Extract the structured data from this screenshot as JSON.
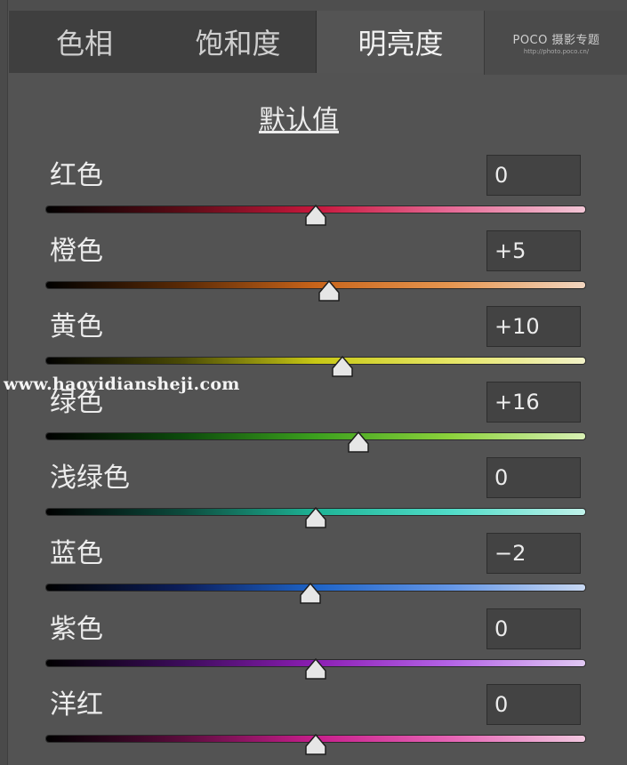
{
  "tabs": [
    {
      "label": "色相",
      "active": false
    },
    {
      "label": "饱和度",
      "active": false
    },
    {
      "label": "明亮度",
      "active": true
    }
  ],
  "logo": {
    "text": "POCO 摄影专题",
    "subtext": "http://photo.poco.cn/"
  },
  "default_link": "默认值",
  "watermark": "www.haoyidiansheji.com",
  "sliders": [
    {
      "label": "红色",
      "value_text": "0",
      "value": 0,
      "gradient": [
        "#000000",
        "#5a0c16",
        "#c8173c",
        "#e66a96",
        "#f2c6d6"
      ]
    },
    {
      "label": "橙色",
      "value_text": "+5",
      "value": 5,
      "gradient": [
        "#000000",
        "#5a2a06",
        "#c8641a",
        "#e69650",
        "#f2d6c0"
      ]
    },
    {
      "label": "黄色",
      "value_text": "+10",
      "value": 10,
      "gradient": [
        "#000000",
        "#4a4a06",
        "#c8c814",
        "#e6e664",
        "#f2f2c8"
      ]
    },
    {
      "label": "绿色",
      "value_text": "+16",
      "value": 16,
      "gradient": [
        "#000000",
        "#0c4a0c",
        "#3ca01e",
        "#8cd23c",
        "#d8f0b4"
      ]
    },
    {
      "label": "浅绿色",
      "value_text": "0",
      "value": 0,
      "gradient": [
        "#000000",
        "#0c4a3c",
        "#1eb496",
        "#50dcc8",
        "#c0f2ea"
      ]
    },
    {
      "label": "蓝色",
      "value_text": "−2",
      "value": -2,
      "gradient": [
        "#000000",
        "#0c1e5a",
        "#1e64c8",
        "#6496e6",
        "#c8d8f2"
      ]
    },
    {
      "label": "紫色",
      "value_text": "0",
      "value": 0,
      "gradient": [
        "#000000",
        "#3c0c5a",
        "#8c1eb4",
        "#b464e6",
        "#e0c8f2"
      ]
    },
    {
      "label": "洋红",
      "value_text": "0",
      "value": 0,
      "gradient": [
        "#000000",
        "#5a0c3c",
        "#c81e8c",
        "#e664b4",
        "#f2c8e0"
      ]
    }
  ],
  "slider_range": [
    -100,
    100
  ],
  "colors": {
    "panel": "#535353",
    "tab_inactive": "#3f3f3f",
    "field": "#434343"
  }
}
